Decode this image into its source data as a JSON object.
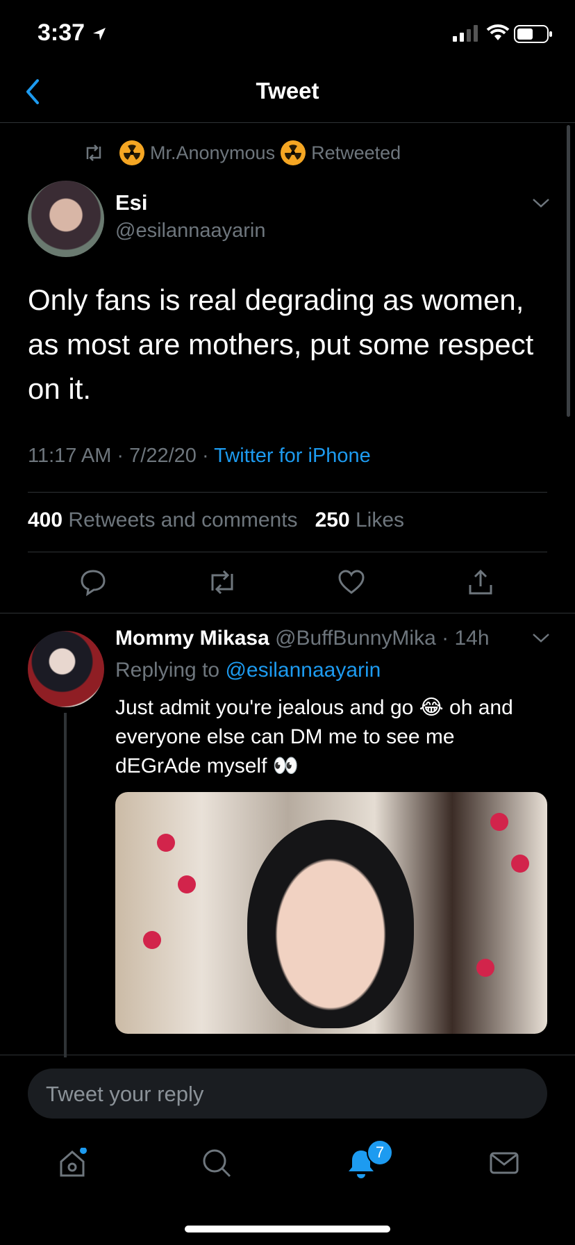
{
  "status": {
    "time": "3:37"
  },
  "nav": {
    "title": "Tweet"
  },
  "retweet": {
    "user": "Mr.Anonymous",
    "label": "Retweeted"
  },
  "tweet": {
    "author_name": "Esi",
    "author_handle": "@esilannaayarin",
    "text": "Only fans is real degrading as women, as most are mothers, put some respect on it.",
    "time": "11:17 AM · 7/22/20 · ",
    "source": "Twitter for iPhone",
    "retweets_count": "400",
    "retweets_label": "Retweets and comments",
    "likes_count": "250",
    "likes_label": "Likes"
  },
  "reply": {
    "author_name": "Mommy Mikasa",
    "author_handle": "@BuffBunnyMika",
    "age": "· 14h",
    "replying_prefix": "Replying to ",
    "replying_to": "@esilannaayarin",
    "text_1": "Just admit you're jealous and go 😂 oh and everyone else can DM me to see me dEGrAde myself 👀"
  },
  "composer": {
    "placeholder": "Tweet your reply"
  },
  "tabbar": {
    "notifications_badge": "7"
  },
  "colors": {
    "accent": "#1d9bf0",
    "background": "#000000",
    "secondary_text": "#6e767d"
  },
  "icons": [
    "location-arrow-icon",
    "signal-icon",
    "wifi-icon",
    "battery-icon",
    "back-chevron-icon",
    "retweet-icon",
    "radioactive-icon",
    "caret-down-icon",
    "reply-icon",
    "heart-icon",
    "share-icon",
    "home-icon",
    "search-icon",
    "bell-icon",
    "mail-icon"
  ]
}
